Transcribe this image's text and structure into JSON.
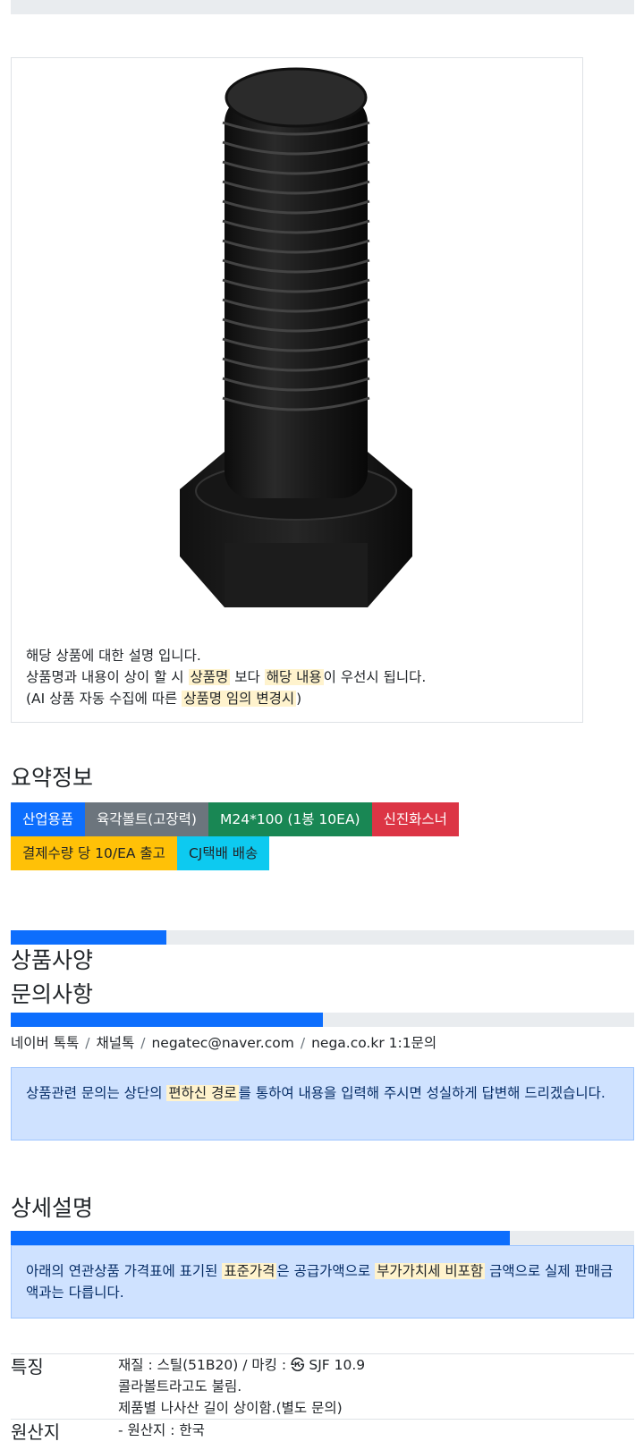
{
  "product": {
    "image_alt": "육각볼트 이미지",
    "desc_line1": "해당 상품에 대한 설명 입니다.",
    "desc_line2_pre": "상품명과 내용이 상이 할 시",
    "desc_line2_mark1": "상품명",
    "desc_line2_mid": "보다",
    "desc_line2_mark2": "해당 내용",
    "desc_line2_post": "이 우선시 됩니다.",
    "desc_line3_pre": "(AI 상품 자동 수집에 따른",
    "desc_line3_mark": "상품명 임의 변경시",
    "desc_line3_post": ")"
  },
  "summary": {
    "title": "요약정보",
    "badges": [
      {
        "label": "산업용품",
        "color": "#0d6efd"
      },
      {
        "label": "육각볼트(고장력)",
        "color": "#6c757d"
      },
      {
        "label": "M24*100 (1봉 10EA)",
        "color": "#198754"
      },
      {
        "label": "신진화스너",
        "color": "#dc3545"
      },
      {
        "label": "결제수량 당 10/EA 출고",
        "color": "#ffc107"
      },
      {
        "label": "CJ택배 배송",
        "color": "#0dcaf0"
      }
    ]
  },
  "progress": {
    "spec_fill": 0.25,
    "inquiry_fill": 0.5,
    "detail_fill": 0.8
  },
  "spec_section": {
    "title": "상품사양"
  },
  "inquiry": {
    "title": "문의사항",
    "links": [
      "네이버 톡톡",
      "채널톡",
      "negatec@naver.com",
      "nega.co.kr 1:1문의"
    ],
    "separator": "/",
    "alert_pre": "상품관련 문의는 상단의",
    "alert_mark": "편하신 경로",
    "alert_post": "를 통하여 내용을 입력해 주시면 성실하게 답변해 드리겠습니다."
  },
  "detail": {
    "title": "상세설명",
    "alert_pre": "아래의 연관상품 가격표에 표기된",
    "alert_mark1": "표준가격",
    "alert_mid": "은 공급가액으로",
    "alert_mark2": "부가가치세 비포함",
    "alert_post": "금액으로 실제 판매금액과는 다릅니다."
  },
  "specs": [
    {
      "key": "특징",
      "lines": [
        "재질 : 스틸(51B20) / 마킹 : ㉿ SJF 10.9",
        "콜라볼트라고도 불림.",
        "제품별 나사산 길이 상이함.(별도 문의)"
      ]
    },
    {
      "key": "원산지",
      "lines": [
        "- 원산지 : 한국"
      ]
    }
  ]
}
